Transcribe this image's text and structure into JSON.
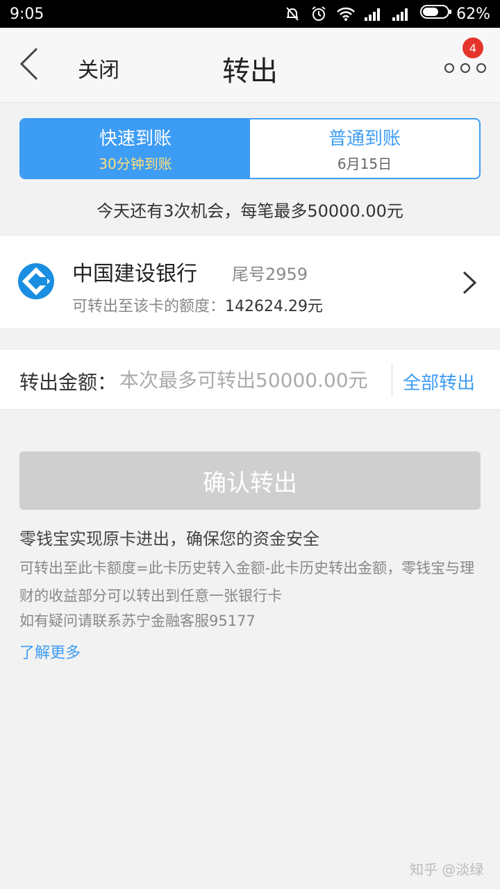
{
  "status_bar": {
    "time": "9:05",
    "battery_percent": "62%",
    "icons": [
      "mute-bell-icon",
      "alarm-icon",
      "wifi-icon",
      "signal-icon",
      "signal-icon",
      "battery-icon"
    ]
  },
  "nav": {
    "back_icon": "chevron-left-icon",
    "close_label": "关闭",
    "title": "转出",
    "more_icon": "more-dots-icon",
    "badge_count": "4"
  },
  "segment": {
    "options": [
      {
        "title": "快速到账",
        "subtitle": "30分钟到账",
        "selected": true
      },
      {
        "title": "普通到账",
        "subtitle": "6月15日",
        "selected": false
      }
    ]
  },
  "chance_text": "今天还有3次机会，每笔最多50000.00元",
  "bank": {
    "name": "中国建设银行",
    "tail": "尾号2959",
    "limit_label": "可转出至该卡的额度：",
    "limit_amount": "142624.29元",
    "logo_icon": "ccb-logo-icon"
  },
  "amount": {
    "label": "转出金额：",
    "placeholder": "本次最多可转出50000.00元",
    "value": "",
    "all_button": "全部转出"
  },
  "confirm_button": "确认转出",
  "info": {
    "title": "零钱宝实现原卡进出，确保您的资金安全",
    "body": "可转出至此卡额度=此卡历史转入金额-此卡历史转出金额，零钱宝与理财的收益部分可以转出到任意一张银行卡",
    "contact": "如有疑问请联系苏宁金融客服95177",
    "learn_more": "了解更多"
  },
  "watermark": "知乎 @淡绿",
  "colors": {
    "accent": "#3d9cf4",
    "badge": "#e5342a",
    "disabled_button": "#cfcfcf",
    "highlight_subtitle": "#ffe07a"
  }
}
